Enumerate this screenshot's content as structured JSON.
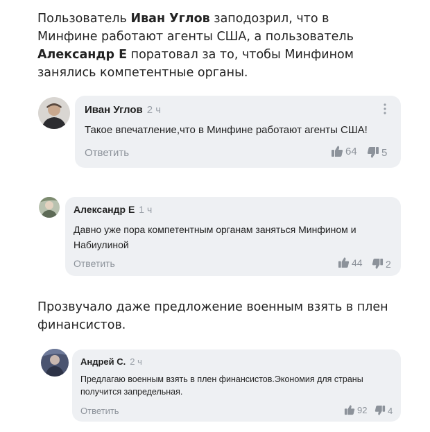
{
  "intro": {
    "part1": "Пользователь ",
    "name1": "Иван Углов",
    "part2": " заподозрил, что в Минфине работают агенты США, а пользователь ",
    "name2": "Александр Е",
    "part3": " поратовал за то, чтобы Минфином занялись компетентные органы."
  },
  "middle_text": "Прозвучало даже предложение военным взять в плен финансистов.",
  "comments": [
    {
      "author": "Иван Углов",
      "time": "2 ч",
      "text": "Такое впечатление,что в Минфине работают агенты США!",
      "reply_label": "Ответить",
      "likes": "64",
      "dislikes": "5"
    },
    {
      "author": "Александр Е",
      "time": "1 ч",
      "text_line1": "Давно уже пора компетентным органам заняться Минфином и",
      "text_line2": "Набиулиной",
      "reply_label": "Ответить",
      "likes": "44",
      "dislikes": "2"
    },
    {
      "author": "Андрей С.",
      "time": "2 ч",
      "text_line1": "Предлагаю военным взять в плен финансистов.Экономия для страны",
      "text_line2": "получится запредельная.",
      "reply_label": "Ответить",
      "likes": "92",
      "dislikes": "4"
    }
  ],
  "icons": {
    "like": "thumbs-up-icon",
    "dislike": "thumbs-down-icon",
    "menu": "more-vertical-icon"
  }
}
